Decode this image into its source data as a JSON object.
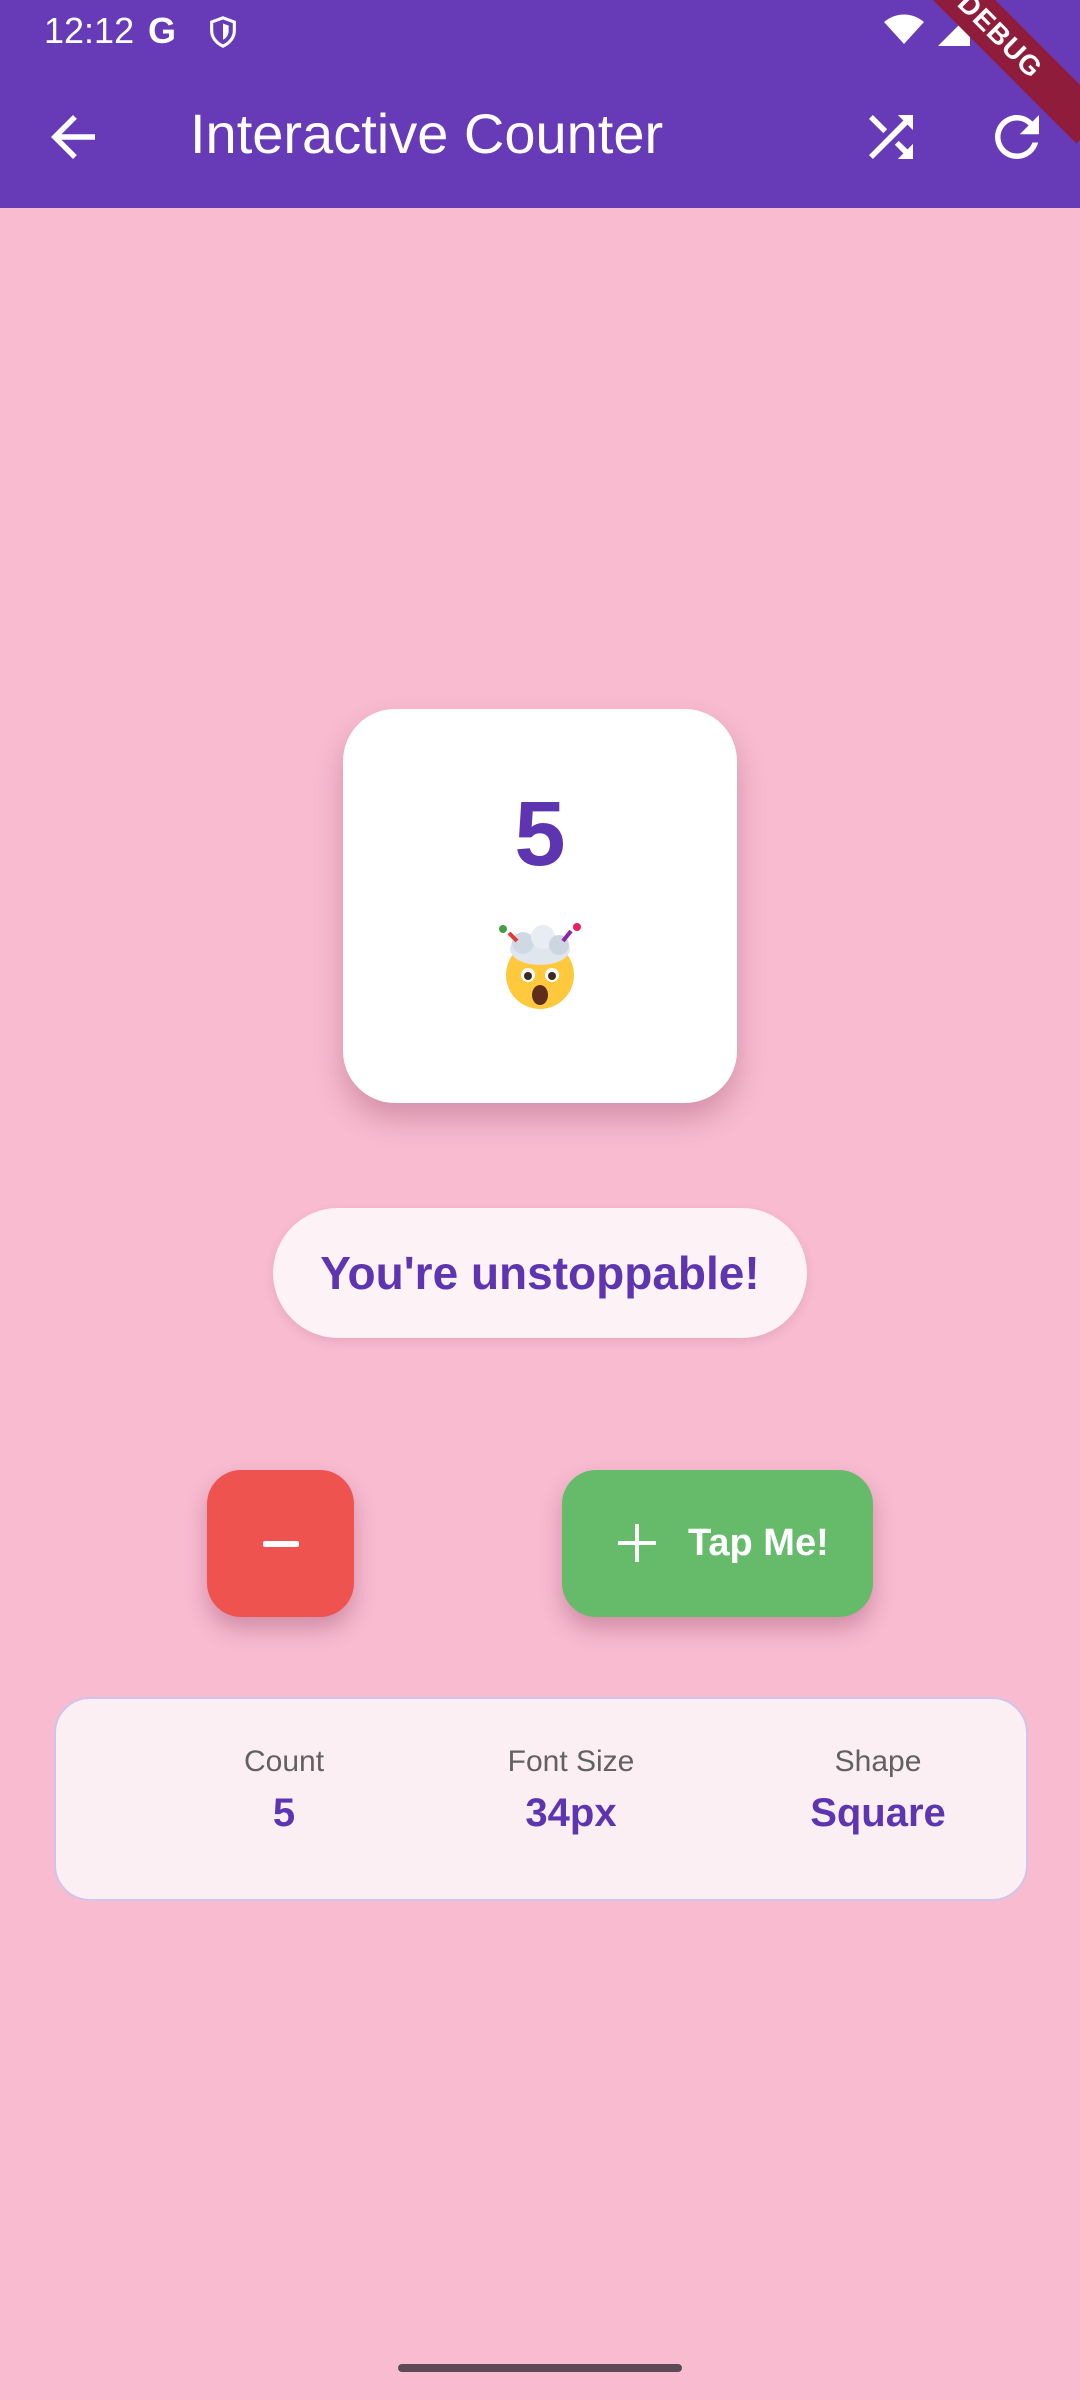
{
  "status_bar": {
    "time": "12:12",
    "g_badge": "G"
  },
  "app_bar": {
    "title": "Interactive Counter",
    "debug_ribbon": "DEBUG"
  },
  "counter": {
    "value": "5",
    "emoji_name": "exploding-head"
  },
  "motivation": {
    "text": "You're unstoppable!"
  },
  "buttons": {
    "decrement_icon": "minus-icon",
    "increment_label": "Tap Me!"
  },
  "info": {
    "count_label": "Count",
    "count_value": "5",
    "font_size_label": "Font Size",
    "font_size_value": "34px",
    "shape_label": "Shape",
    "shape_value": "Square"
  },
  "colors": {
    "app_bar": "#673AB7",
    "background": "#F8BBD0",
    "accent_text": "#5E35B1",
    "decrement": "#EF5350",
    "increment": "#66BB6A"
  }
}
